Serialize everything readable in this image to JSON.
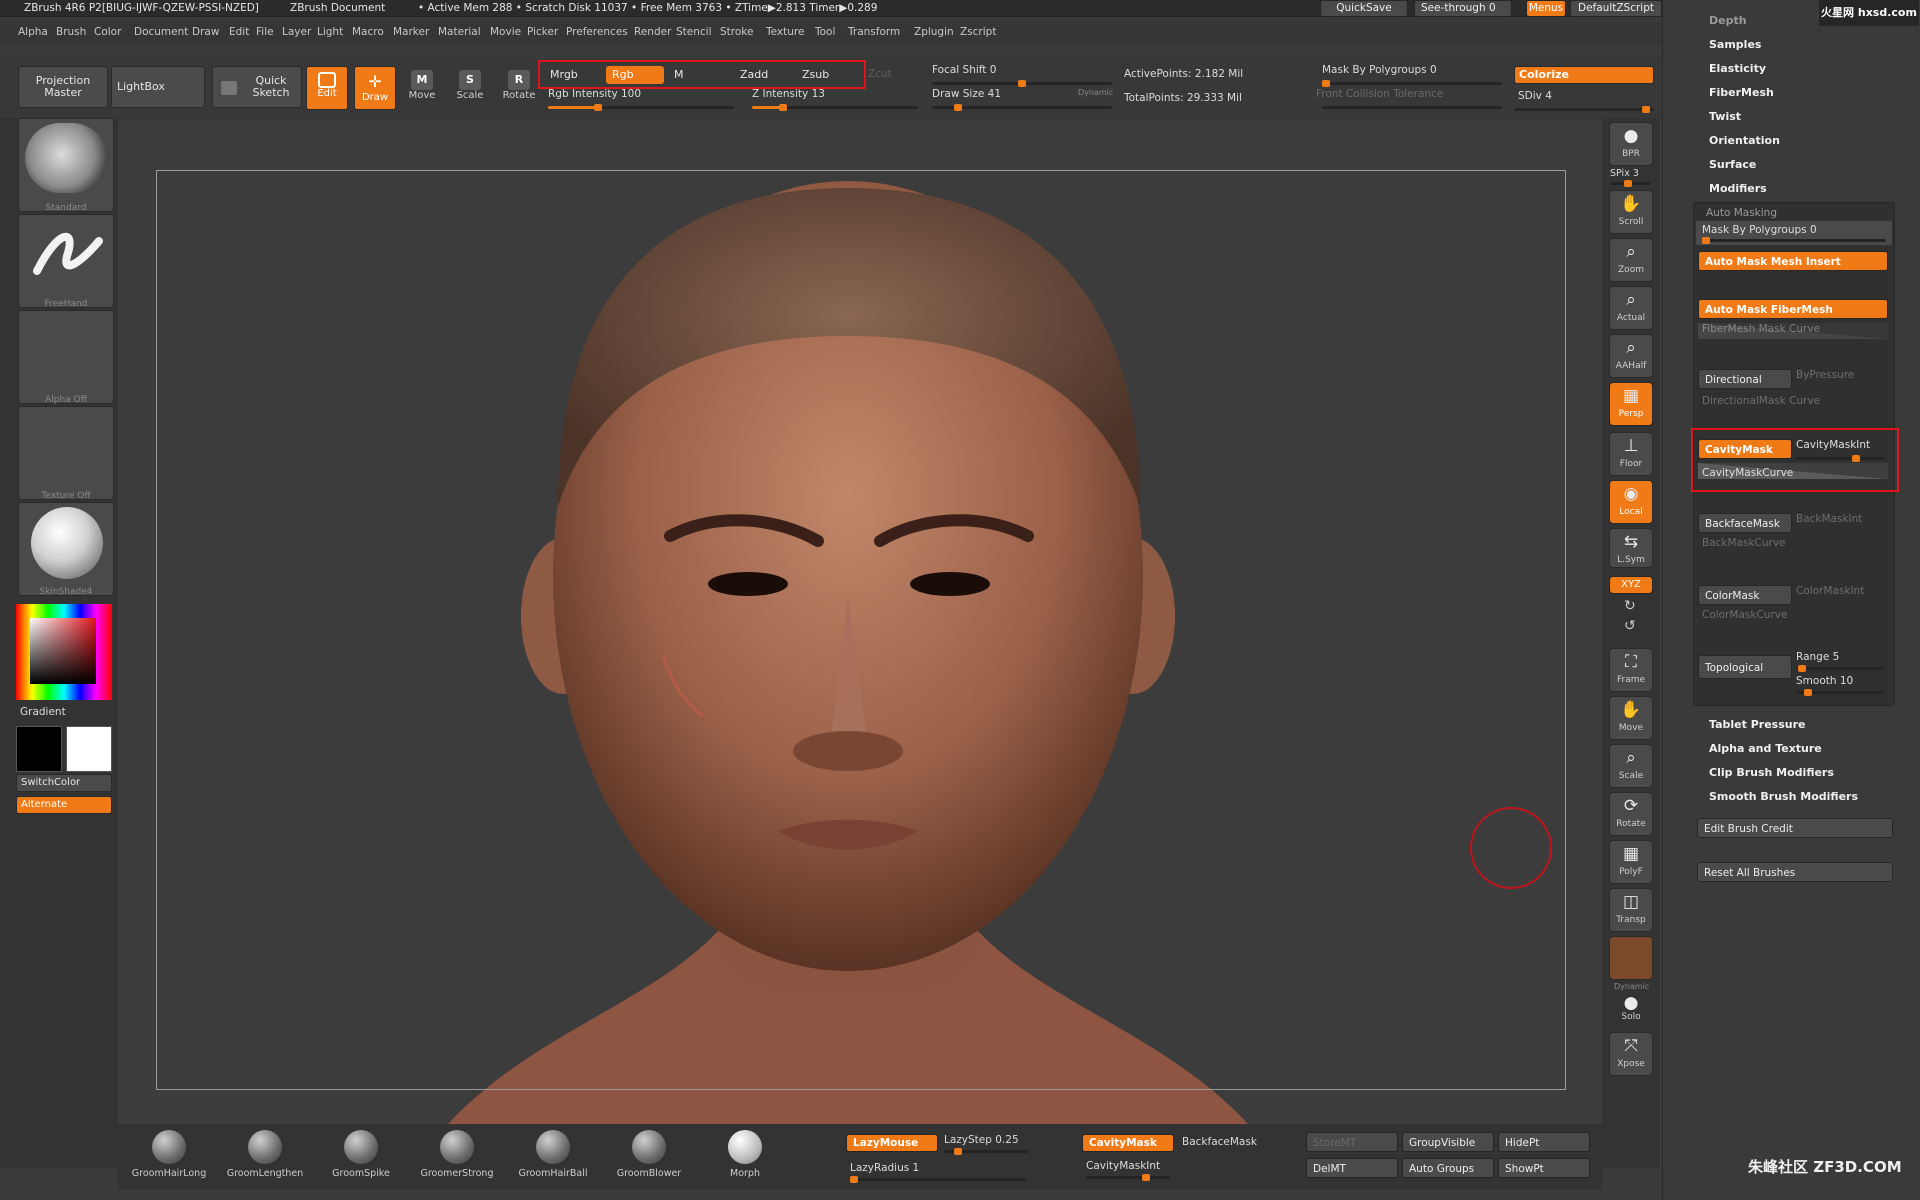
{
  "titlebar": {
    "app": "ZBrush 4R6 P2[BIUG-IJWF-QZEW-PSSI-NZED]",
    "doc": "ZBrush Document",
    "stats": "• Active Mem 288 • Scratch Disk 11037 • Free Mem 3763 • ZTime▶2.813 Timer▶0.289",
    "quicksave": "QuickSave",
    "seethrough": "See-through",
    "seethrough_val": "0",
    "menus": "Menus",
    "script": "DefaultZScript"
  },
  "menus": [
    "Alpha",
    "Brush",
    "Color",
    "Document",
    "Draw",
    "Edit",
    "File",
    "Layer",
    "Light",
    "Macro",
    "Marker",
    "Material",
    "Movie",
    "Picker",
    "Preferences",
    "Render",
    "Stencil",
    "Stroke",
    "Texture",
    "Tool",
    "Transform",
    "Zplugin",
    "Zscript"
  ],
  "toolbar": {
    "projection": "Projection Master",
    "lightbox": "LightBox",
    "quicksketch": "Quick Sketch",
    "edit": "Edit",
    "draw": "Draw",
    "move": "Move",
    "scale": "Scale",
    "rotate": "Rotate",
    "mrgb": "Mrgb",
    "rgb": "Rgb",
    "m": "M",
    "zadd": "Zadd",
    "zsub": "Zsub",
    "zcut": "Zcut",
    "rgb_intensity": "Rgb Intensity 100",
    "z_intensity": "Z Intensity 13",
    "focal_shift": "Focal Shift 0",
    "draw_size": "Draw Size 41",
    "dynamic": "Dynamic",
    "active_points": "ActivePoints: 2.182 Mil",
    "total_points": "TotalPoints: 29.333 Mil",
    "mask_by_polygroups": "Mask By Polygroups 0",
    "front_collision": "Front Collision Tolerance",
    "colorize": "Colorize",
    "sdiv": "SDiv 4",
    "rgb_intensity_pct": 100,
    "z_intensity_pct": 13,
    "draw_size_val": 41
  },
  "leftshelf": {
    "brush": "Standard",
    "stroke": "FreeHand",
    "alpha": "Alpha Off",
    "texture": "Texture Off",
    "material": "SkinShade4",
    "gradient": "Gradient",
    "switchcolor": "SwitchColor",
    "alternate": "Alternate"
  },
  "rightshelf": {
    "bpr": "BPR",
    "spix": "SPix 3",
    "scroll": "Scroll",
    "zoom": "Zoom",
    "actual": "Actual",
    "aahalf": "AAHalf",
    "persp": "Persp",
    "floor": "Floor",
    "local": "Local",
    "lsym": "L.Sym",
    "xyz": "XYZ",
    "frame": "Frame",
    "move": "Move",
    "scale": "Scale",
    "rotate": "Rotate",
    "polyf": "PolyF",
    "transp": "Transp",
    "dynamic": "Dynamic",
    "solo": "Solo",
    "xpose": "Xpose"
  },
  "panel": {
    "depth": "Depth",
    "samples": "Samples",
    "elasticity": "Elasticity",
    "fibermesh": "FiberMesh",
    "twist": "Twist",
    "orientation": "Orientation",
    "surface": "Surface",
    "modifiers": "Modifiers",
    "auto_masking": "Auto Masking",
    "mask_by_polygroups": "Mask By Polygroups 0",
    "auto_mask_mesh_insert": "Auto Mask Mesh Insert",
    "auto_mask_fibermesh": "Auto Mask FiberMesh",
    "fibermesh_mask_curve": "FiberMesh Mask Curve",
    "directional": "Directional",
    "bypressure": "ByPressure",
    "directional_mask_curve": "DirectionalMask Curve",
    "cavitymask": "CavityMask",
    "cavitymaskint": "CavityMaskInt",
    "cavitymaskcurve": "CavityMaskCurve",
    "backfacemask": "BackfaceMask",
    "backmaskint": "BackMaskInt",
    "backmaskcurve": "BackMaskCurve",
    "colormask": "ColorMask",
    "colormaskint": "ColorMaskInt",
    "colormaskcurve": "ColorMaskCurve",
    "topological": "Topological",
    "range": "Range 5",
    "smooth": "Smooth 10",
    "tablet_pressure": "Tablet Pressure",
    "alpha_texture": "Alpha and Texture",
    "clip_brush": "Clip Brush Modifiers",
    "smooth_brush": "Smooth Brush Modifiers",
    "edit_brush_credit": "Edit Brush Credit",
    "reset_all_brushes": "Reset All Brushes"
  },
  "bottom": {
    "brushes": [
      "GroomHairLong",
      "GroomLengthen",
      "GroomSpike",
      "GroomerStrong",
      "GroomHairBall",
      "GroomBlower",
      "Morph"
    ],
    "lazymouse": "LazyMouse",
    "lazystep": "LazyStep 0.25",
    "lazyradius": "LazyRadius 1",
    "cavitymask": "CavityMask",
    "backfacemask": "BackfaceMask",
    "cavitymaskint": "CavityMaskInt",
    "storemt": "StoreMT",
    "delmt": "DelMT",
    "groupvisible": "GroupVisible",
    "autogroups": "Auto Groups",
    "hidept": "HidePt",
    "showpt": "ShowPt"
  },
  "watermark": {
    "top": "火星网 hxsd.com",
    "bottom": "朱峰社区 ZF3D.COM"
  },
  "colors": {
    "accent": "#f07a16",
    "highlight": "#e0141b"
  }
}
